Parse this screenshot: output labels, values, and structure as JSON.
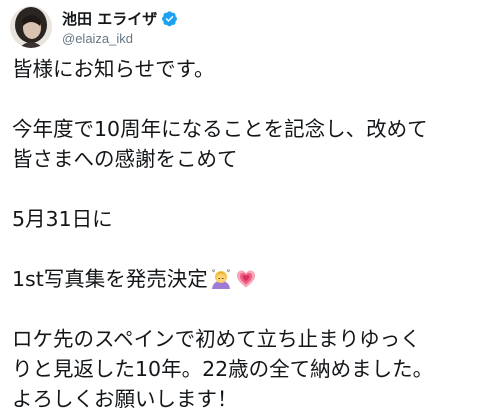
{
  "user": {
    "display_name": "池田 エライザ",
    "handle": "@elaiza_ikd"
  },
  "icons": {
    "verified": "verified-badge-icon",
    "emoji_1": "person-bowing-emoji",
    "emoji_2": "growing-heart-emoji"
  },
  "colors": {
    "verified": "#1da1f2",
    "handle": "#657786",
    "text": "#14171a"
  },
  "tweet": {
    "line_1": "皆様にお知らせです。",
    "line_2": "今年度で10周年になることを記念し、改めて",
    "line_3": "皆さまへの感謝をこめて",
    "line_4": "5月31日に",
    "line_5": "1st写真集を発売決定",
    "line_6": "ロケ先のスペインで初めて立ち止まりゆっく",
    "line_7": "りと見返した10年。22歳の全て納めました。",
    "line_8": "よろしくお願いします！"
  }
}
